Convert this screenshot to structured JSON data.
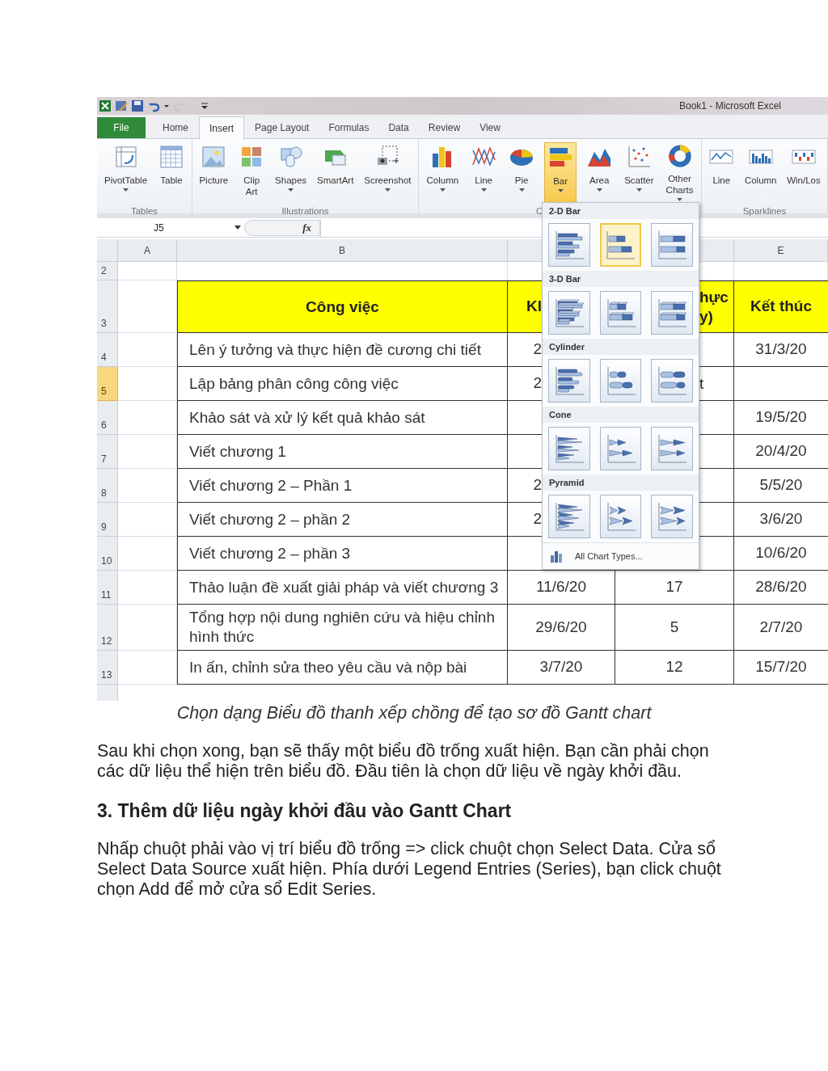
{
  "window": {
    "title": "Book1 - Microsoft Excel"
  },
  "quick_access": [
    {
      "kind": "logo",
      "disabled": false
    },
    {
      "kind": "save-as",
      "disabled": false
    },
    {
      "kind": "save",
      "disabled": false
    },
    {
      "kind": "undo",
      "disabled": false
    },
    {
      "kind": "caret",
      "disabled": false
    },
    {
      "kind": "redo",
      "disabled": true
    },
    {
      "kind": "caret",
      "disabled": true
    },
    {
      "kind": "customize",
      "disabled": false
    }
  ],
  "tabs": [
    {
      "label": "File",
      "kind": "file",
      "selected": false
    },
    {
      "label": "Home",
      "kind": "tab",
      "selected": false
    },
    {
      "label": "Insert",
      "kind": "tab",
      "selected": true
    },
    {
      "label": "Page Layout",
      "kind": "tab",
      "selected": false
    },
    {
      "label": "Formulas",
      "kind": "tab",
      "selected": false
    },
    {
      "label": "Data",
      "kind": "tab",
      "selected": false
    },
    {
      "label": "Review",
      "kind": "tab",
      "selected": false
    },
    {
      "label": "View",
      "kind": "tab",
      "selected": false
    }
  ],
  "ribbon": {
    "groups": [
      {
        "label": "Tables",
        "buttons": [
          {
            "label": "PivotTable",
            "dropdown": true,
            "expanded": false
          },
          {
            "label": "Table",
            "dropdown": false,
            "expanded": false
          }
        ]
      },
      {
        "label": "Illustrations",
        "buttons": [
          {
            "label": "Picture",
            "dropdown": false,
            "expanded": false
          },
          {
            "label": "Clip Art",
            "dropdown": false,
            "expanded": false
          },
          {
            "label": "Shapes",
            "dropdown": true,
            "expanded": false
          },
          {
            "label": "SmartArt",
            "dropdown": false,
            "expanded": false
          },
          {
            "label": "Screenshot",
            "dropdown": true,
            "expanded": false
          }
        ]
      },
      {
        "label": "C",
        "buttons": [
          {
            "label": "Column",
            "dropdown": true,
            "expanded": false
          },
          {
            "label": "Line",
            "dropdown": true,
            "expanded": false
          },
          {
            "label": "Pie",
            "dropdown": true,
            "expanded": false
          },
          {
            "label": "Bar",
            "dropdown": true,
            "expanded": true
          },
          {
            "label": "Area",
            "dropdown": true,
            "expanded": false
          },
          {
            "label": "Scatter",
            "dropdown": true,
            "expanded": false
          },
          {
            "label": "Other Charts",
            "dropdown": true,
            "expanded": false
          }
        ]
      },
      {
        "label": "Sparklines",
        "buttons": [
          {
            "label": "Line",
            "dropdown": false,
            "expanded": false
          },
          {
            "label": "Column",
            "dropdown": false,
            "expanded": false
          },
          {
            "label": "Win/Los",
            "dropdown": false,
            "expanded": false
          }
        ]
      }
    ]
  },
  "formula_bar": {
    "name_box": "J5",
    "fx": "fx"
  },
  "sheet": {
    "columns": [
      {
        "label": "A"
      },
      {
        "label": "B"
      },
      {},
      {},
      {
        "label": "E"
      }
    ],
    "rows": [
      {
        "num": "2",
        "kind": "blank",
        "selected": false
      },
      {
        "num": "3",
        "kind": "header",
        "selected": false,
        "cells": {
          "b": "Công việc",
          "c": "Kl",
          "d": "hực y)",
          "e": "Kết thúc"
        }
      },
      {
        "num": "4",
        "kind": "data",
        "selected": false,
        "cells": {
          "b": "Lên ý tưởng và thực hiện đề cương chi tiết",
          "c": "2",
          "e": "31/3/20"
        }
      },
      {
        "num": "5",
        "kind": "data",
        "selected": true,
        "cells": {
          "b": "Lập bảng phân công công việc",
          "c": "2",
          "d": "t"
        }
      },
      {
        "num": "6",
        "kind": "data",
        "selected": false,
        "cells": {
          "b": "Khảo sát và xử lý kết quả khảo sát",
          "e": "19/5/20"
        }
      },
      {
        "num": "7",
        "kind": "data",
        "selected": false,
        "cells": {
          "b": "Viết chương 1",
          "e": "20/4/20"
        }
      },
      {
        "num": "8",
        "kind": "data",
        "selected": false,
        "cells": {
          "b": "Viết chương 2 – Phần 1",
          "c": "2",
          "e": "5/5/20"
        }
      },
      {
        "num": "9",
        "kind": "data",
        "selected": false,
        "cells": {
          "b": "Viết chương 2 – phần 2",
          "c": "2",
          "e": "3/6/20"
        }
      },
      {
        "num": "10",
        "kind": "data",
        "selected": false,
        "cells": {
          "b": "Viết chương 2 – phần 3",
          "e": "10/6/20"
        }
      },
      {
        "num": "11",
        "kind": "data",
        "selected": false,
        "cells": {
          "b": "Thảo luận đề xuất giải pháp và viết chương 3",
          "c": "11/6/20",
          "d": "17",
          "e": "28/6/20"
        }
      },
      {
        "num": "12",
        "kind": "data",
        "selected": false,
        "cells": {
          "b": "Tổng hợp nội dung nghiên cứu và hiệu chỉnh hình thức",
          "c": "29/6/20",
          "d": "5",
          "e": "2/7/20"
        }
      },
      {
        "num": "13",
        "kind": "data",
        "selected": false,
        "cells": {
          "b": "In ấn, chỉnh sửa theo yêu cầu và nộp bài",
          "c": "3/7/20",
          "d": "12",
          "e": "15/7/20"
        }
      }
    ]
  },
  "dropdown": {
    "sections": [
      {
        "title": "2-D Bar",
        "kind": "flat",
        "options": [
          {
            "selected": false
          },
          {
            "selected": true
          },
          {
            "selected": false
          }
        ]
      },
      {
        "title": "3-D Bar",
        "kind": "box",
        "options": [
          {
            "selected": false
          },
          {
            "selected": false
          },
          {
            "selected": false
          }
        ]
      },
      {
        "title": "Cylinder",
        "kind": "cylinder",
        "options": [
          {
            "selected": false
          },
          {
            "selected": false
          },
          {
            "selected": false
          }
        ]
      },
      {
        "title": "Cone",
        "kind": "cone",
        "options": [
          {
            "selected": false
          },
          {
            "selected": false
          },
          {
            "selected": false
          }
        ]
      },
      {
        "title": "Pyramid",
        "kind": "pyramid",
        "options": [
          {
            "selected": false
          },
          {
            "selected": false
          },
          {
            "selected": false
          }
        ]
      }
    ],
    "footer": "All Chart Types..."
  },
  "caption": "Chọn dạng Biểu đồ thanh xếp chồng để tạo sơ đồ Gantt chart",
  "article": [
    {
      "kind": "paragraph",
      "text": "Sau khi chọn xong, bạn sẽ thấy một biểu đồ trống xuất hiện. Bạn cần phải chọn các dữ liệu thể hiện trên biểu đồ. Đầu tiên là chọn dữ liệu về ngày khởi đầu."
    },
    {
      "kind": "heading",
      "text": "3. Thêm dữ liệu ngày khởi đầu vào Gantt Chart"
    },
    {
      "kind": "paragraph",
      "text": "Nhấp chuột phải vào vị trí biểu đồ trống => click chuột chọn Select Data. Cửa sổ Select Data Source xuất hiện. Phía dưới Legend Entries (Series), bạn click chuột chọn Add để mở cửa sổ Edit Series."
    }
  ]
}
